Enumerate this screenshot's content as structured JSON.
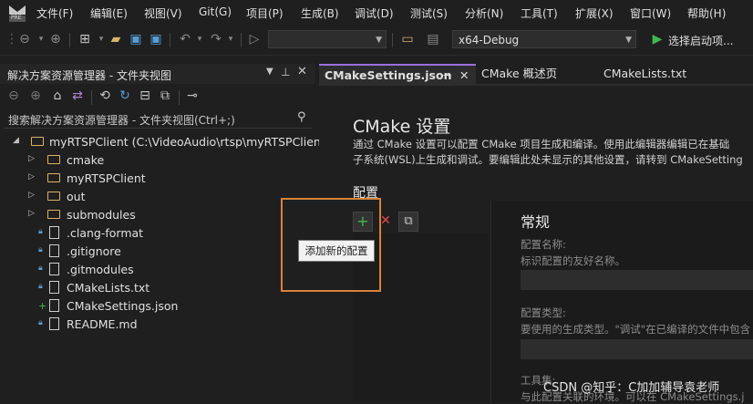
{
  "menubar": {
    "items": [
      "文件(F)",
      "编辑(E)",
      "视图(V)",
      "Git(G)",
      "项目(P)",
      "生成(B)",
      "调试(D)",
      "测试(S)",
      "分析(N)",
      "工具(T)",
      "扩展(X)",
      "窗口(W)",
      "帮助(H)"
    ],
    "logo_badge": "PRE"
  },
  "toolbar": {
    "config_value": "x64-Debug",
    "run_label": "选择启动项...",
    "run_color": "#3fb950"
  },
  "solution_explorer": {
    "title": "解决方案资源管理器 - 文件夹视图",
    "search_placeholder": "搜索解决方案资源管理器 - 文件夹视图(Ctrl+;)",
    "root": "myRTSPClient (C:\\VideoAudio\\rtsp\\myRTSPClient)",
    "folders": [
      "cmake",
      "myRTSPClient",
      "out",
      "submodules"
    ],
    "files": [
      ".clang-format",
      ".gitignore",
      ".gitmodules",
      "CMakeLists.txt",
      "CMakeSettings.json",
      "README.md"
    ]
  },
  "editor": {
    "tabs": [
      "CMakeSettings.json",
      "CMake 概述页",
      "CMakeLists.txt"
    ],
    "tab_pin": "⊸",
    "heading": "CMake 设置",
    "desc_line1": "通过 CMake 设置可以配置 CMake 项目生成和编译。使用此编辑器编辑已在基础",
    "desc_line2": "子系统(WSL)上生成和调试。要编辑此处未显示的其他设置，请转到 CMakeSetting",
    "config_label": "配置",
    "tooltip": "添加新的配置",
    "general": {
      "title": "常规",
      "name_label": "配置名称:",
      "name_hint": "标识配置的友好名称。",
      "type_label": "配置类型:",
      "type_hint": "要使用的生成类型。\"调试\"在已编译的文件中包含",
      "toolset_label": "工具集:",
      "toolset_hint": "与此配置关联的环境。可以在 CMakeSettings.j"
    }
  },
  "watermark": "CSDN @知乎：C加加辅导袁老师",
  "colors": {
    "accent": "#9b6fe0",
    "highlight": "#d9823b",
    "add": "#3fb950",
    "delete": "#e5484d"
  }
}
